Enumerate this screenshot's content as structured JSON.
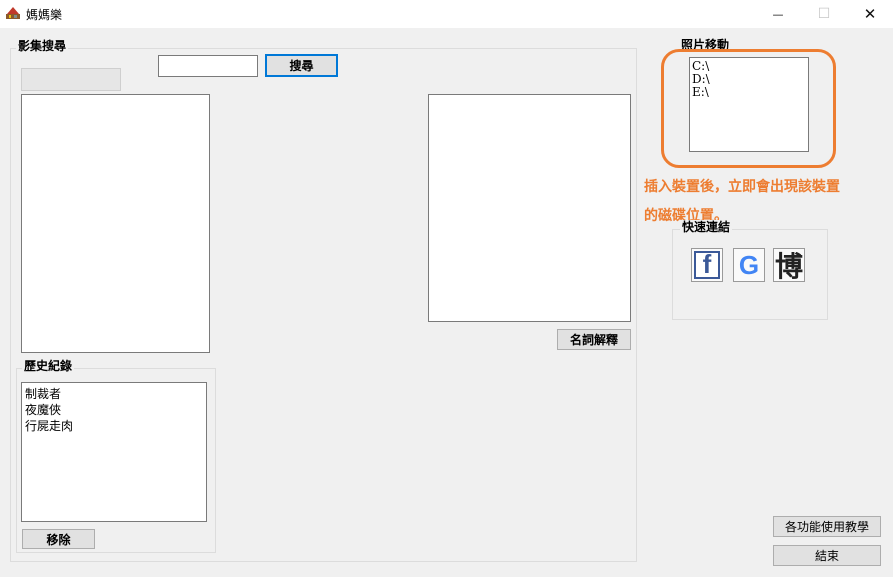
{
  "window": {
    "title": "媽媽樂",
    "minimize_glyph": "—",
    "maximize_glyph": "☐",
    "close_glyph": "✕"
  },
  "search_group": {
    "label": "影集搜尋",
    "query_value": "",
    "search_button": "搜尋",
    "glossary_button": "名詞解釋"
  },
  "history": {
    "label": "歷史紀錄",
    "items": [
      "制裁者",
      "夜魔俠",
      "行屍走肉"
    ],
    "remove_button": "移除"
  },
  "photo_move": {
    "label": "照片移動",
    "drives": [
      "C:\\",
      "D:\\",
      "E:\\"
    ]
  },
  "annotation": {
    "line1": "插入裝置後，立即會出現該裝置",
    "line2": "的磁碟位置。",
    "color": "#ed7d31"
  },
  "quick_links": {
    "label": "快速連結",
    "facebook_glyph": "f",
    "google_glyph": "G",
    "bo_glyph": "博"
  },
  "footer": {
    "tutorial_button": "各功能使用教學",
    "exit_button": "結束"
  }
}
